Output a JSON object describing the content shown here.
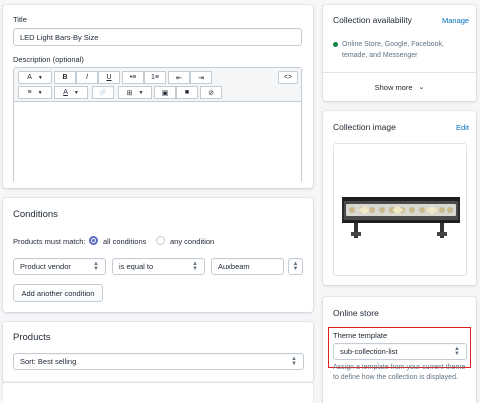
{
  "details": {
    "title_label": "Title",
    "title_value": "LED Light Bars-By Size",
    "description_label": "Description (optional)"
  },
  "toolbar": {
    "row1": [
      "A",
      "B",
      "I",
      "U",
      "•≡",
      "1≡",
      "⇤",
      "⇥",
      "<>"
    ],
    "row2": [
      "≡",
      "A",
      "🔗",
      "⊞",
      "▣",
      "■",
      "⊘"
    ]
  },
  "conditions": {
    "heading": "Conditions",
    "match_label": "Products must match:",
    "option_all": "all conditions",
    "option_any": "any condition",
    "field": "Product vendor",
    "operator": "is equal to",
    "value": "Auxbeam",
    "add_button": "Add another condition"
  },
  "products": {
    "heading": "Products",
    "sort": "Sort: Best selling"
  },
  "availability": {
    "heading": "Collection availability",
    "manage": "Manage",
    "channels": "Online Store, Google, Facebook, temade, and Messenger",
    "show_more": "Show more",
    "dot_color": "#108043"
  },
  "image_card": {
    "heading": "Collection image",
    "edit": "Edit"
  },
  "online_store": {
    "heading": "Online store",
    "template_label": "Theme template",
    "template_value": "sub-collection-list",
    "help_text": "Assign a template from your current theme to define how the collection is displayed."
  },
  "colors": {
    "accent": "#5c6ac4",
    "link": "#006fbb",
    "highlight": "#e0201f"
  }
}
